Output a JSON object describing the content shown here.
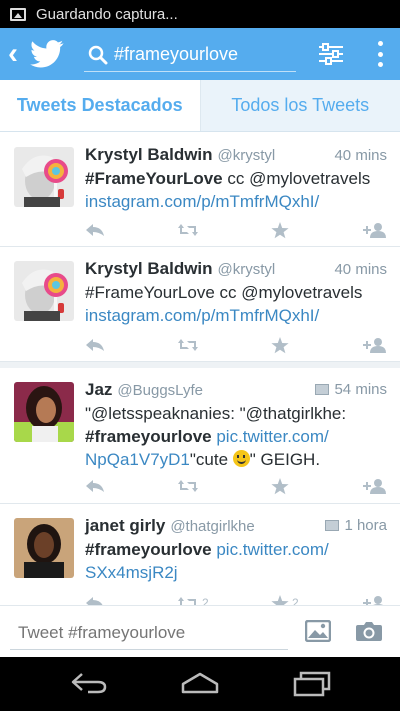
{
  "status_bar": {
    "notification": "Guardando captura..."
  },
  "search": {
    "query": "#frameyourlove"
  },
  "tabs": [
    {
      "label": "Tweets Destacados"
    },
    {
      "label": "Todos los Tweets"
    }
  ],
  "tweets": [
    {
      "name": "Krystyl Baldwin",
      "handle": "@krystyl",
      "time": "40 mins",
      "hashtag": "#FrameYourLove",
      "text": " cc @mylovetravels",
      "link": "instagram.com/p/mTmfrMQxhI/"
    },
    {
      "name": "Krystyl Baldwin",
      "handle": "@krystyl",
      "time": "40 mins",
      "text": "#FrameYourLove cc @mylovetravels",
      "link": "instagram.com/p/mTmfrMQxhI/"
    },
    {
      "name": "Jaz",
      "handle": "@BuggsLyfe",
      "time": "54 mins",
      "line1": "\"@letsspeaknanies: \"@thatgirlkhe:",
      "hashtag": "#frameyourlove",
      "link_a": " pic.twitter.com/",
      "link_b": "NpQa1V7yD1",
      "tail_a": "\"cute ",
      "tail_b": "\" GEIGH."
    },
    {
      "name": "janet girly",
      "handle": "@thatgirlkhe",
      "time": "1 hora",
      "hashtag": "#frameyourlove",
      "link_a": " pic.twitter.com/",
      "link_b": "SXx4msjR2j",
      "retweet_count": "2",
      "favorite_count": "2"
    }
  ],
  "composer": {
    "placeholder": "Tweet #frameyourlove"
  },
  "colors": {
    "brand": "#55acee",
    "link": "#3b88c3",
    "icon_muted": "#b1bec8"
  },
  "icons": [
    "back-chevron-icon",
    "twitter-bird-icon",
    "search-icon",
    "filter-icon",
    "overflow-menu-icon",
    "reply-icon",
    "retweet-icon",
    "favorite-icon",
    "follow-icon",
    "photo-icon",
    "camera-icon",
    "nav-back-icon",
    "nav-home-icon",
    "nav-recents-icon"
  ]
}
